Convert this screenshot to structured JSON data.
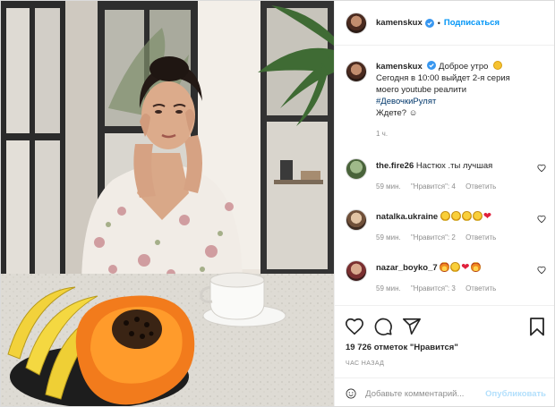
{
  "header": {
    "username": "kamenskux",
    "follow_label": "Подписаться",
    "dot": "•"
  },
  "caption": {
    "username": "kamenskux",
    "greeting": "Доброе утро",
    "line2": "Сегодня в 10:00 выйдет 2-я серия",
    "line3": "моего youtube реалити",
    "hashtag": "#ДевочкиРулят",
    "line5": "Ждете? ☺",
    "time": "1 ч."
  },
  "comments": [
    {
      "username": "the.fire26",
      "text": "Настюх .ты лучшая",
      "time": "59 мин.",
      "likes": "\"Нравится\": 4",
      "reply": "Ответить",
      "emoji": []
    },
    {
      "username": "natalka.ukraine",
      "text": "",
      "time": "59 мин.",
      "likes": "\"Нравится\": 2",
      "reply": "Ответить",
      "emoji": [
        "cry",
        "cry",
        "cry",
        "cry",
        "heart"
      ]
    },
    {
      "username": "nazar_boyko_7",
      "text": "",
      "time": "59 мин.",
      "likes": "\"Нравится\": 3",
      "reply": "Ответить",
      "emoji": [
        "fire",
        "grin",
        "heart",
        "fire"
      ]
    }
  ],
  "actions": {
    "likes_count": "19 726",
    "likes_word": "отметок \"Нравится\"",
    "time_ago": "ЧАС НАЗАД"
  },
  "add_comment": {
    "placeholder": "Добавьте комментарий...",
    "publish_label": "Опубликовать"
  },
  "icons": {
    "verified": "verified-badge-icon",
    "heart": "heart-icon",
    "comment": "comment-icon",
    "share": "share-icon",
    "bookmark": "bookmark-icon",
    "emoji": "emoji-icon"
  },
  "colors": {
    "accent": "#0095f6",
    "link_dark": "#00376b",
    "muted": "#8e8e8e",
    "publish_disabled": "#b2dffc"
  }
}
